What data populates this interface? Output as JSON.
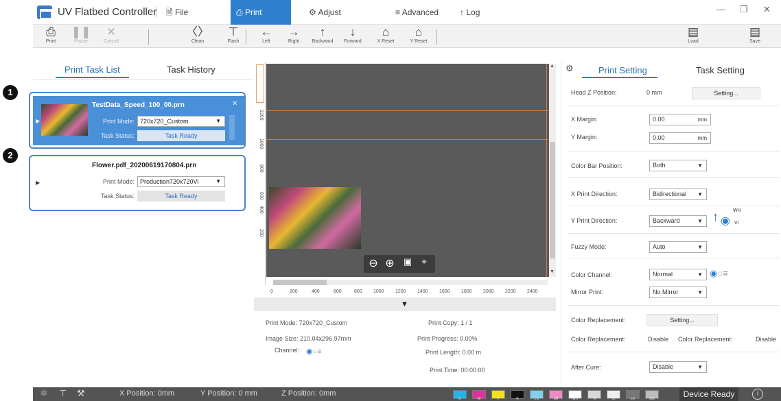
{
  "app": {
    "title": "UV Flatbed Controller"
  },
  "menu": {
    "file": "File",
    "print": "Print",
    "adjust": "Adjust",
    "advanced": "Advanced",
    "log": "Log"
  },
  "toolbar": {
    "print": "Print",
    "pause": "Pause",
    "cancel": "Cancel",
    "clean": "Clean",
    "flash": "Flash",
    "left": "Left",
    "right": "Right",
    "backward": "Backward",
    "forward": "Forward",
    "x_reset": "X Reset",
    "y_reset": "Y Reset",
    "load": "Load",
    "save": "Save"
  },
  "left": {
    "tab_list": "Print Task List",
    "tab_history": "Task History",
    "tasks": [
      {
        "file": "TestData_Speed_100_00.prn",
        "mode_label": "Print Mode:",
        "mode": "720x720_Custom",
        "status_label": "Task Status:",
        "status": "Task Ready"
      },
      {
        "file": "Flower.pdf_20200619170804.prn",
        "mode_label": "Print Mode:",
        "mode": "Production720x720Vi",
        "status_label": "Task Status:",
        "status": "Task Ready"
      }
    ],
    "badges": [
      "1",
      "2"
    ]
  },
  "ruler": {
    "h": [
      "0",
      "200",
      "400",
      "600",
      "800",
      "1000",
      "1200",
      "1400",
      "1600",
      "1800",
      "2000",
      "2200",
      "2400"
    ],
    "v": [
      "1200",
      "1000",
      "800",
      "600",
      "400",
      "200"
    ]
  },
  "info": {
    "print_mode": "Print Mode: 720x720_Custom",
    "image_size": "Image Size: 210.04x296.97mm",
    "channel": "Channel:",
    "copy": "Print Copy: 1 / 1",
    "progress": "Print Progress: 0.00%",
    "length": "Print Length: 0.00 m",
    "time": "Print Time: 00:00:00"
  },
  "right": {
    "tab_print": "Print Setting",
    "tab_task": "Task Setting",
    "head_z_label": "Head Z Position:",
    "head_z_value": "0 mm",
    "setting": "Setting...",
    "x_margin_label": "X Margin:",
    "x_margin": "0.00",
    "y_margin_label": "Y Margin:",
    "y_margin": "0.00",
    "unit": "mm",
    "color_bar_label": "Color Bar Position:",
    "color_bar": "Both",
    "x_dir_label": "X Print Direction:",
    "x_dir": "Bidirectional",
    "y_dir_label": "Y Print Direction:",
    "y_dir": "Backward",
    "wh": "WH",
    "vi": "Vi",
    "fuzzy_label": "Fuzzy Mode:",
    "fuzzy": "Auto",
    "channel_label": "Color Channel:",
    "channel": "Normal",
    "mirror_label": "Mirror Print:",
    "mirror": "No Mirror",
    "repl_label": "Color Replacement:",
    "repl_setting": "Setting...",
    "repl2_label": "Color Replacement:",
    "repl_disable": "Disable",
    "repl_text": "Color Replacement:",
    "repl_disable2": "Disable",
    "after_label": "After Cure:",
    "after": "Disable"
  },
  "status": {
    "x": "X Position: 0mm",
    "y": "Y Position: 0 mm",
    "z": "Z Position: 0mm",
    "device": "Device Ready",
    "inks": [
      "C",
      "M",
      "Y",
      "K",
      "LC",
      "LM",
      "WH",
      "Vi",
      "Cl",
      "LK",
      "Sfe"
    ]
  }
}
